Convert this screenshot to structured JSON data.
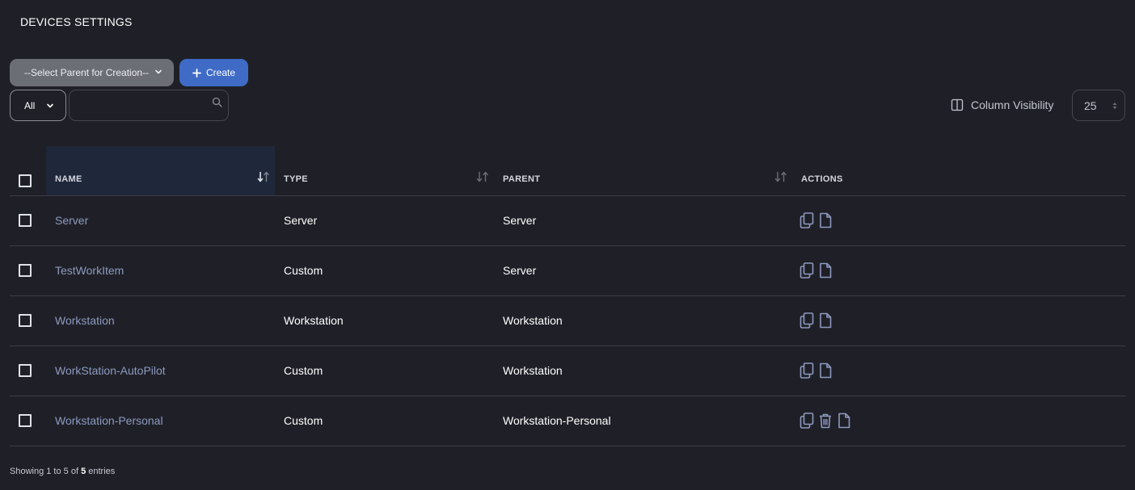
{
  "page": {
    "title": "DEVICES SETTINGS"
  },
  "toolbar": {
    "parent_select_label": "--Select Parent for Creation--",
    "create_label": "Create",
    "filter_value": "All",
    "search_value": "",
    "column_visibility_label": "Column Visibility",
    "page_size_value": "25"
  },
  "table": {
    "columns": [
      "NAME",
      "TYPE",
      "PARENT",
      "ACTIONS"
    ],
    "rows": [
      {
        "name": "Server",
        "type": "Server",
        "parent": "Server",
        "actions": [
          "copy",
          "document"
        ]
      },
      {
        "name": "TestWorkItem",
        "type": "Custom",
        "parent": "Server",
        "actions": [
          "copy",
          "document"
        ]
      },
      {
        "name": "Workstation",
        "type": "Workstation",
        "parent": "Workstation",
        "actions": [
          "copy",
          "document"
        ]
      },
      {
        "name": "WorkStation-AutoPilot",
        "type": "Custom",
        "parent": "Workstation",
        "actions": [
          "copy",
          "document"
        ]
      },
      {
        "name": "Workstation-Personal",
        "type": "Custom",
        "parent": "Workstation-Personal",
        "actions": [
          "copy",
          "delete",
          "document"
        ]
      }
    ]
  },
  "footer": {
    "prefix": "Showing 1 to 5 of ",
    "total": "5",
    "suffix": " entries"
  },
  "colors": {
    "background": "#1f2027",
    "primary": "#3f6bc6",
    "link": "#8d9ac0",
    "icon": "#8e99bf",
    "sorted_header": "#1f273a"
  }
}
